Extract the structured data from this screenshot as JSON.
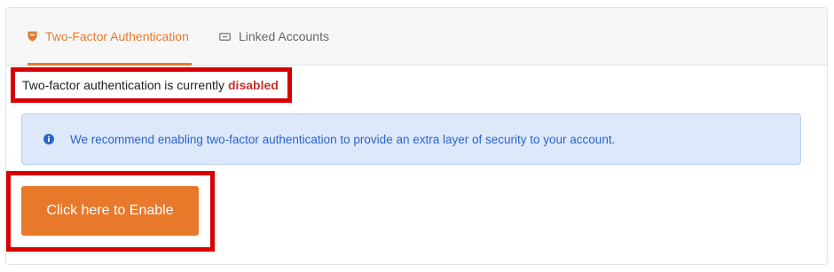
{
  "tabs": [
    {
      "label": "Two-Factor Authentication",
      "icon": "shield-icon",
      "active": true
    },
    {
      "label": "Linked Accounts",
      "icon": "link-icon",
      "active": false
    }
  ],
  "status": {
    "prefix": "Two-factor authentication is currently",
    "state": "disabled"
  },
  "alert": {
    "icon": "info-icon",
    "message": "We recommend enabling two-factor authentication to provide an extra layer of security to your account."
  },
  "enable_button": {
    "label": "Click here to Enable"
  },
  "colors": {
    "accent": "#e8792a",
    "danger": "#c9302c",
    "highlight_border": "#d80000",
    "info_bg": "#dde9fb",
    "info_text": "#2a64c8"
  }
}
